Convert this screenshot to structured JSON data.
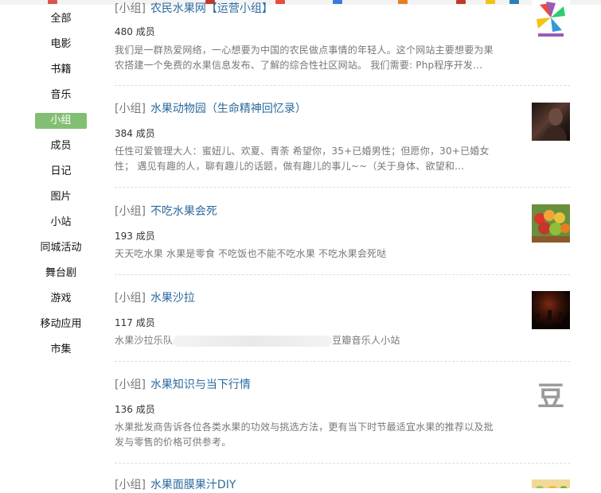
{
  "colors": {
    "accent": "#83bf73",
    "link": "#2b6a9e",
    "muted": "#777777"
  },
  "sidebar": {
    "items": [
      {
        "label": "全部"
      },
      {
        "label": "电影"
      },
      {
        "label": "书籍"
      },
      {
        "label": "音乐"
      },
      {
        "label": "小组",
        "active": true
      },
      {
        "label": "成员"
      },
      {
        "label": "日记"
      },
      {
        "label": "图片"
      },
      {
        "label": "小站"
      },
      {
        "label": "同城活动"
      },
      {
        "label": "舞台剧"
      },
      {
        "label": "游戏"
      },
      {
        "label": "移动应用"
      },
      {
        "label": "市集"
      }
    ]
  },
  "results": [
    {
      "tag": "[小组]",
      "title": "农民水果网【运营小组】",
      "members": "480 成员",
      "desc1": "我们是一群热爱网络，一心想要为中国的农民做点事情的年轻人。这个网站主要想要为果",
      "desc2": "农搭建一个免费的水果信息发布、了解的综合性社区网站。 我们需要: Php程序开发...",
      "thumb_icon": "pinwheel-logo-thumbnail"
    },
    {
      "tag": "[小组]",
      "title": "水果动物园（生命精神回忆录）",
      "members": "384 成员",
      "desc1": "任性可爱管理大人：蜜妞儿、欢夏、青荼 希望你，35+已婚男性；但愿你，30+已婚女",
      "desc2": "性； 遇见有趣的人，聊有趣儿的话题，做有趣儿的事儿~~（关于身体、欲望和...",
      "thumb_icon": "dark-portrait-thumbnail"
    },
    {
      "tag": "[小组]",
      "title": "不吃水果会死",
      "members": "193 成员",
      "desc1": "天天吃水果 水果是零食 不吃饭也不能不吃水果 不吃水果会死哒",
      "thumb_icon": "fruit-basket-thumbnail"
    },
    {
      "tag": "[小组]",
      "title": "水果沙拉",
      "members": "117 成员",
      "desc_prefix": "水果沙拉乐队",
      "desc_suffix": "豆瓣音乐人小站",
      "thumb_icon": "dark-stage-thumbnail"
    },
    {
      "tag": "[小组]",
      "title": "水果知识与当下行情",
      "members": "136 成员",
      "desc1": "水果批发商告诉各位各类水果的功效与挑选方法，更有当下时节最适宜水果的推荐以及批",
      "desc2": "发与零售的价格可供参考。",
      "thumb_char": "豆",
      "thumb_icon": "douban-default-icon"
    },
    {
      "tag": "[小组]",
      "title": "水果面膜果汁DIY",
      "thumb_icon": "fruit-slices-thumbnail"
    }
  ]
}
